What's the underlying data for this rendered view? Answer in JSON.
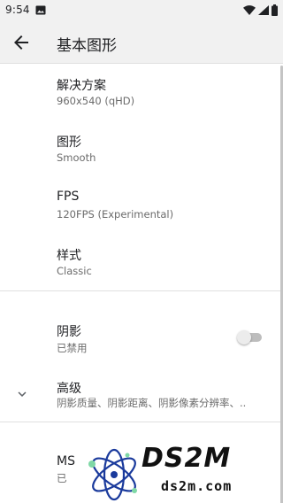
{
  "status_bar": {
    "time": "9:54",
    "icons": [
      "photo-icon",
      "wifi-icon",
      "cell-signal-icon",
      "battery-icon"
    ]
  },
  "app_bar": {
    "title": "基本图形",
    "back_icon": "arrow-back-icon"
  },
  "preferences": [
    {
      "title": "解决方案",
      "summary": "960x540 (qHD)"
    },
    {
      "title": "图形",
      "summary": "Smooth"
    },
    {
      "title": "FPS",
      "summary": "120FPS (Experimental)"
    },
    {
      "title": "样式",
      "summary": "Classic"
    }
  ],
  "shadow_pref": {
    "title": "阴影",
    "summary": "已禁用",
    "switch_on": false
  },
  "advanced_pref": {
    "title": "高级",
    "summary": "阴影质量、阴影距离、阴影像素分辨率、..",
    "icon": "chevron-down-icon"
  },
  "msaa_pref": {
    "title": "MS",
    "summary": "已"
  },
  "watermark": {
    "brand": "DS2M",
    "domain": "ds2m.com"
  },
  "colors": {
    "background": "#ffffff",
    "app_bar": "#f1f1f1",
    "text_primary": "#202124",
    "text_secondary": "#6b6b6b",
    "divider": "#e0e0e0",
    "watermark_accent": "#1a3a9c"
  }
}
